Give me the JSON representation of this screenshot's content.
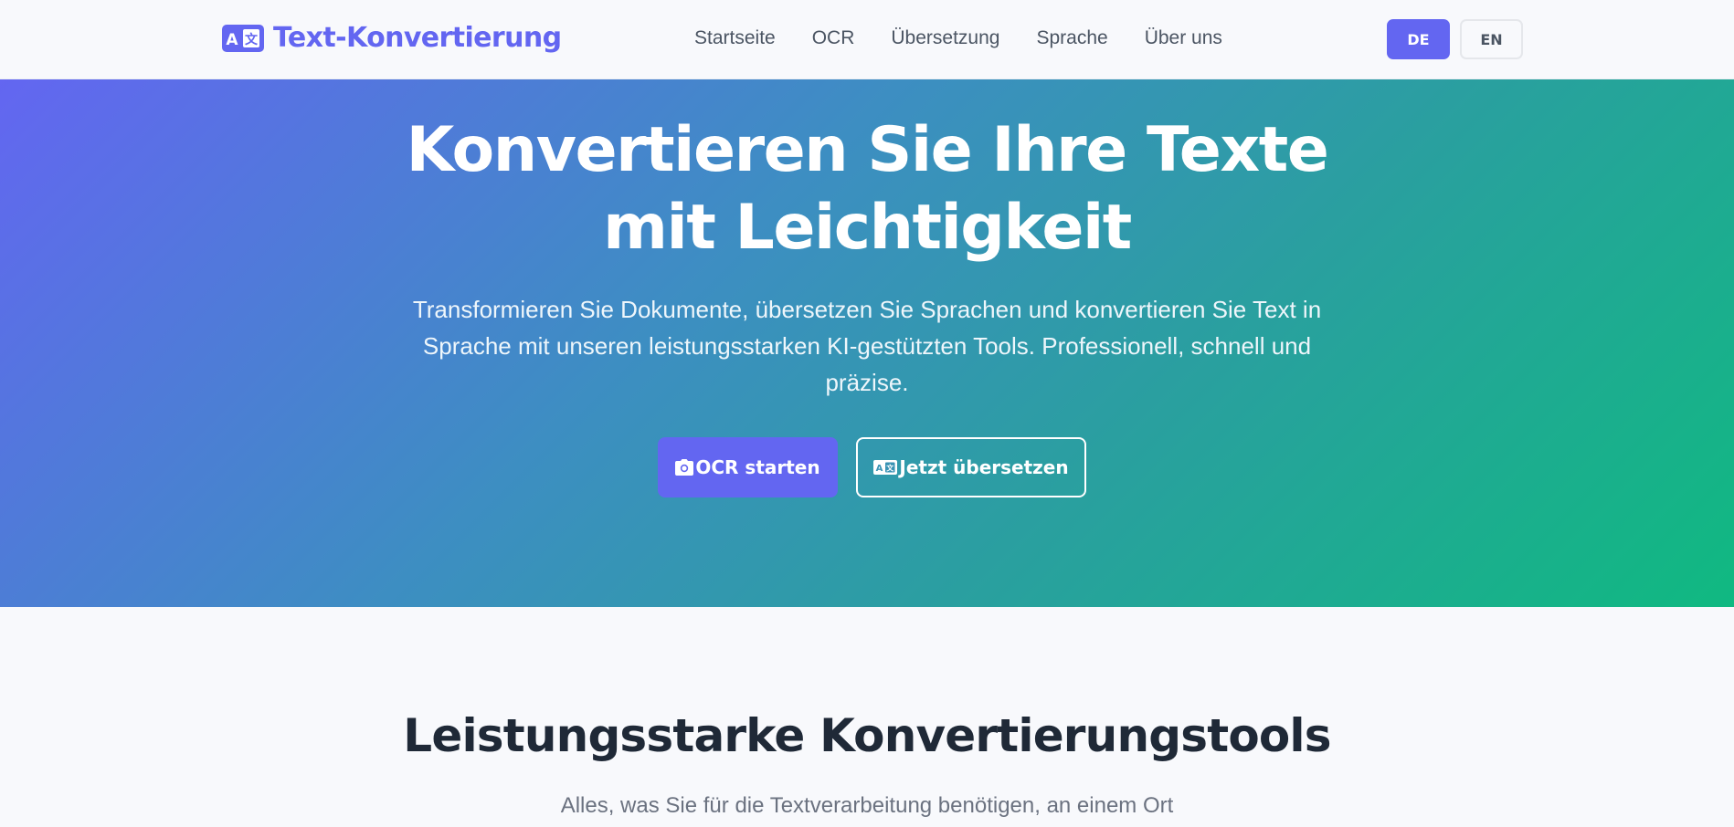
{
  "header": {
    "brand": {
      "name": "Text-Konvertierung",
      "icon": "translate-icon"
    },
    "nav": [
      {
        "label": "Startseite"
      },
      {
        "label": "OCR"
      },
      {
        "label": "Übersetzung"
      },
      {
        "label": "Sprache"
      },
      {
        "label": "Über uns"
      }
    ],
    "languages": [
      {
        "label": "DE",
        "active": true
      },
      {
        "label": "EN",
        "active": false
      }
    ]
  },
  "hero": {
    "title_line1": "Konvertieren Sie Ihre Texte",
    "title_line2": "mit Leichtigkeit",
    "subtitle": "Transformieren Sie Dokumente, übersetzen Sie Sprachen und konvertieren Sie Text in Sprache mit unseren leistungsstarken KI-gestützten Tools. Professionell, schnell und präzise.",
    "primary_button": {
      "label": "OCR starten",
      "icon": "camera-icon"
    },
    "secondary_button": {
      "label": "Jetzt übersetzen",
      "icon": "translate-icon"
    }
  },
  "features": {
    "title": "Leistungsstarke Konvertierungstools",
    "subtitle": "Alles, was Sie für die Textverarbeitung benötigen, an einem Ort"
  },
  "colors": {
    "accent": "#6366f1",
    "gradient_start": "#6366f1",
    "gradient_end": "#10b981",
    "background": "#f8f9fc",
    "heading": "#1f2937",
    "muted": "#6b7280"
  }
}
